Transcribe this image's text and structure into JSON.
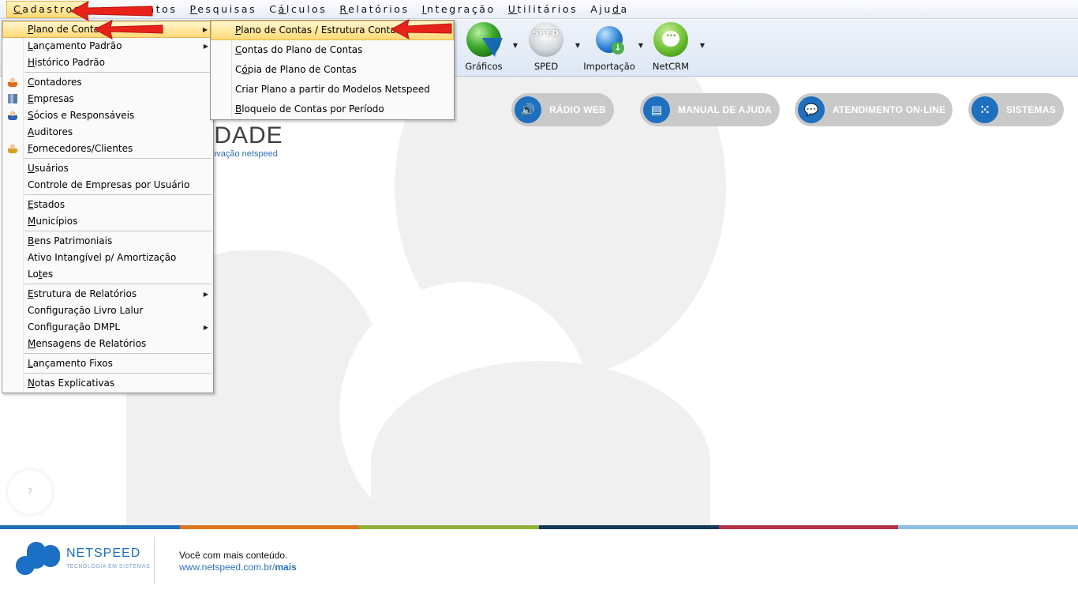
{
  "menubar": {
    "items": [
      {
        "label": "Cadastros",
        "mnemonic": "C",
        "rest": "adastros"
      },
      {
        "label": "Lançamentos",
        "mnemonic": "L",
        "rest": "ançamentos",
        "visible_part": "amentos"
      },
      {
        "label": "Pesquisas",
        "mnemonic": "P",
        "rest": "esquisas"
      },
      {
        "label": "Cálculos",
        "mnemonic": "á",
        "pre": "C",
        "rest": "lculos"
      },
      {
        "label": "Relatórios",
        "mnemonic": "R",
        "rest": "elatórios"
      },
      {
        "label": "Integração",
        "mnemonic": "I",
        "rest": "ntegração"
      },
      {
        "label": "Utilitários",
        "mnemonic": "U",
        "rest": "tilitários"
      },
      {
        "label": "Ajuda",
        "pre": "Aju",
        "mnemonic": "d",
        "rest": "a"
      }
    ]
  },
  "toolbar": {
    "buttons": [
      {
        "label": "Gráficos",
        "icon": "chart-globe-icon"
      },
      {
        "label": "SPED",
        "icon": "sped-icon",
        "icon_text": "SPED"
      },
      {
        "label": "Importação",
        "icon": "import-globe-icon"
      },
      {
        "label": "NetCRM",
        "icon": "chat-bubble-icon"
      }
    ]
  },
  "cadastros_menu": {
    "items": [
      {
        "label": "Plano de Contas",
        "mn": "P",
        "rest": "lano de Contas",
        "submenu": true,
        "highlight": true
      },
      {
        "label": "Lançamento Padrão",
        "mn": "L",
        "rest": "ançamento Padrão",
        "submenu": true
      },
      {
        "label": "Histórico Padrão",
        "mn": "H",
        "rest": "istórico Padrão"
      },
      {
        "sep": true
      },
      {
        "label": "Contadores",
        "mn": "C",
        "rest": "ontadores",
        "icon": "person-icon"
      },
      {
        "label": "Empresas",
        "mn": "E",
        "rest": "mpresas",
        "icon": "building-icon"
      },
      {
        "label": "Sócios e Responsáveis",
        "mn": "S",
        "rest": "ócios e Responsáveis",
        "icon": "person-blue-icon"
      },
      {
        "label": "Auditores",
        "mn": "A",
        "rest": "uditores"
      },
      {
        "label": "Fornecedores/Clientes",
        "mn": "F",
        "rest": "ornecedores/Clientes",
        "icon": "person-yellow-icon"
      },
      {
        "sep": true
      },
      {
        "label": "Usuários",
        "mn": "U",
        "rest": "suários"
      },
      {
        "label": "Controle de Empresas por Usuário",
        "plain": true
      },
      {
        "sep": true
      },
      {
        "label": "Estados",
        "mn": "E",
        "rest": "stados"
      },
      {
        "label": "Municípios",
        "mn": "M",
        "rest": "unicípios"
      },
      {
        "sep": true
      },
      {
        "label": "Bens Patrimoniais",
        "mn": "B",
        "rest": "ens Patrimoniais"
      },
      {
        "label": "Ativo Intangível p/ Amortização",
        "plain": true
      },
      {
        "label": "Lotes",
        "pre": "Lo",
        "mn": "t",
        "rest": "es"
      },
      {
        "sep": true
      },
      {
        "label": "Estrutura de Relatórios",
        "mn": "E",
        "rest": "strutura de Relatórios",
        "submenu": true
      },
      {
        "label": "Configuração Livro Lalur",
        "plain": true
      },
      {
        "label": "Configuração DMPL",
        "plain": true,
        "submenu": true
      },
      {
        "label": "Mensagens de Relatórios",
        "mn": "M",
        "rest": "ensagens de Relatórios"
      },
      {
        "sep": true
      },
      {
        "label": "Lançamento Fixos",
        "mn": "L",
        "rest": "ançamento Fixos"
      },
      {
        "sep": true
      },
      {
        "label": "Notas Explicativas",
        "mn": "N",
        "rest": "otas Explicativas"
      }
    ]
  },
  "plano_submenu": {
    "items": [
      {
        "label": "Plano de Contas / Estrutura Contas",
        "mn": "P",
        "rest": "lano de Contas / Estrutura Contas",
        "highlight": true
      },
      {
        "label": "Contas do Plano de Contas",
        "mn": "C",
        "rest": "ontas do Plano de Contas"
      },
      {
        "label": "Cópia de Plano de Contas",
        "pre": "C",
        "mn": "ó",
        "rest": "pia de Plano de Contas"
      },
      {
        "label": "Criar Plano a partir do Modelos Netspeed",
        "plain": true
      },
      {
        "label": "Bloqueio de Contas por Período",
        "mn": "B",
        "rest": "loqueio de Contas por Período"
      }
    ]
  },
  "main": {
    "logo_text": "IDADE",
    "logo_sub": "novação netspeed",
    "pills": [
      {
        "label": "RÁDIO WEB",
        "icon": "speaker-icon",
        "glyph": "🔊"
      },
      {
        "label": "MANUAL DE AJUDA",
        "icon": "book-icon",
        "glyph": "▤"
      },
      {
        "label": "ATENDIMENTO ON-LINE",
        "icon": "chat-icon",
        "glyph": "💬"
      },
      {
        "label": "SISTEMAS",
        "icon": "grid-icon",
        "glyph": "⁙"
      }
    ],
    "help_bubble": "?"
  },
  "footer": {
    "brand": "NETSPEED",
    "tagline": "TECNOLOGIA EM SISTEMAS",
    "line1": "Você com mais conteúdo.",
    "link_prefix": "www.netspeed.com.br/",
    "link_bold": "mais",
    "colors": [
      "#1f6fb7",
      "#d9761f",
      "#8fb13a",
      "#133a5a",
      "#b1324b",
      "#8dbfe6"
    ]
  },
  "colors": {
    "menu_highlight": "#ffd975",
    "pill_bg": "#c9c9c9",
    "pill_icon": "#1f6fbf",
    "arrow": "#e8231b"
  }
}
